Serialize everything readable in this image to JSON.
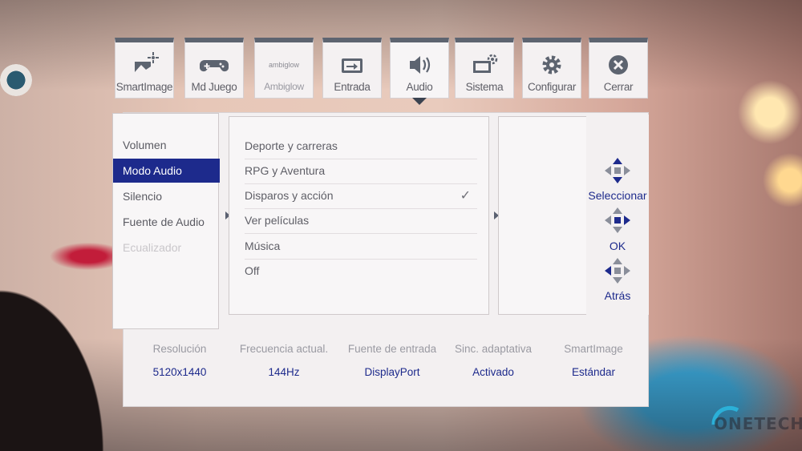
{
  "tabs": [
    {
      "label": "SmartImage",
      "icon": "smartimage-icon"
    },
    {
      "label": "Md Juego",
      "icon": "gamepad-icon"
    },
    {
      "label": "Ambiglow",
      "icon": "ambiglow-icon",
      "logo_text": "ambiglow"
    },
    {
      "label": "Entrada",
      "icon": "input-icon"
    },
    {
      "label": "Audio",
      "icon": "speaker-icon",
      "active": true
    },
    {
      "label": "Sistema",
      "icon": "system-icon"
    },
    {
      "label": "Configurar",
      "icon": "gear-icon"
    },
    {
      "label": "Cerrar",
      "icon": "close-icon"
    }
  ],
  "audio_menu": [
    {
      "label": "Volumen"
    },
    {
      "label": "Modo Audio",
      "selected": true
    },
    {
      "label": "Silencio"
    },
    {
      "label": "Fuente de Audio"
    },
    {
      "label": "Ecualizador",
      "disabled": true
    }
  ],
  "audio_modes": [
    {
      "label": "Deporte y carreras"
    },
    {
      "label": "RPG y Aventura"
    },
    {
      "label": "Disparos y acción",
      "checked": true
    },
    {
      "label": "Ver películas"
    },
    {
      "label": "Música"
    },
    {
      "label": "Off"
    }
  ],
  "check_mark": "✓",
  "navigation": [
    {
      "label": "Seleccionar",
      "icon": "dpad-up-down-icon"
    },
    {
      "label": "OK",
      "icon": "dpad-center-icon"
    },
    {
      "label": "Atrás",
      "icon": "dpad-left-icon"
    }
  ],
  "status_bar": [
    {
      "label": "Resolución",
      "value": "5120x1440"
    },
    {
      "label": "Frecuencia actual.",
      "value": "144Hz"
    },
    {
      "label": "Fuente de entrada",
      "value": "DisplayPort"
    },
    {
      "label": "Sinc. adaptativa",
      "value": "Activado"
    },
    {
      "label": "SmartImage",
      "value": "Estándar"
    }
  ],
  "watermark": "ONETECH",
  "colors": {
    "accent": "#1d2a8c",
    "panel_bg": "#f3f0f1",
    "tab_top": "#5d6470",
    "text": "#5e5e66",
    "disabled_text": "#c9c6ca"
  }
}
